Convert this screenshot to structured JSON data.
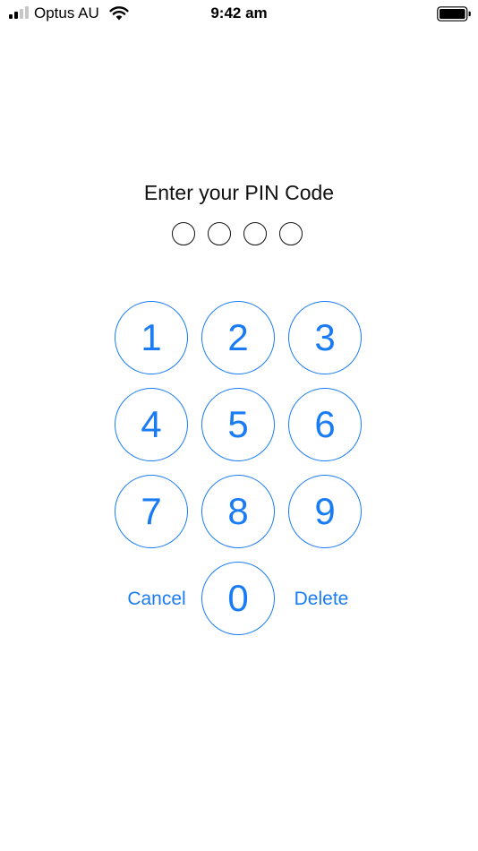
{
  "status_bar": {
    "carrier": "Optus AU",
    "time": "9:42 am",
    "signal_bars_filled": 2,
    "signal_bars_total": 4,
    "wifi_icon": "wifi-icon",
    "battery_icon": "battery-icon",
    "battery_level": 0.9
  },
  "pin_entry": {
    "prompt": "Enter your PIN Code",
    "digits_total": 4,
    "digits_entered": 0
  },
  "keypad": {
    "keys": [
      "1",
      "2",
      "3",
      "4",
      "5",
      "6",
      "7",
      "8",
      "9",
      "0"
    ],
    "cancel_label": "Cancel",
    "delete_label": "Delete"
  },
  "colors": {
    "accent": "#1a7cf5",
    "text": "#111111",
    "background": "#ffffff"
  }
}
